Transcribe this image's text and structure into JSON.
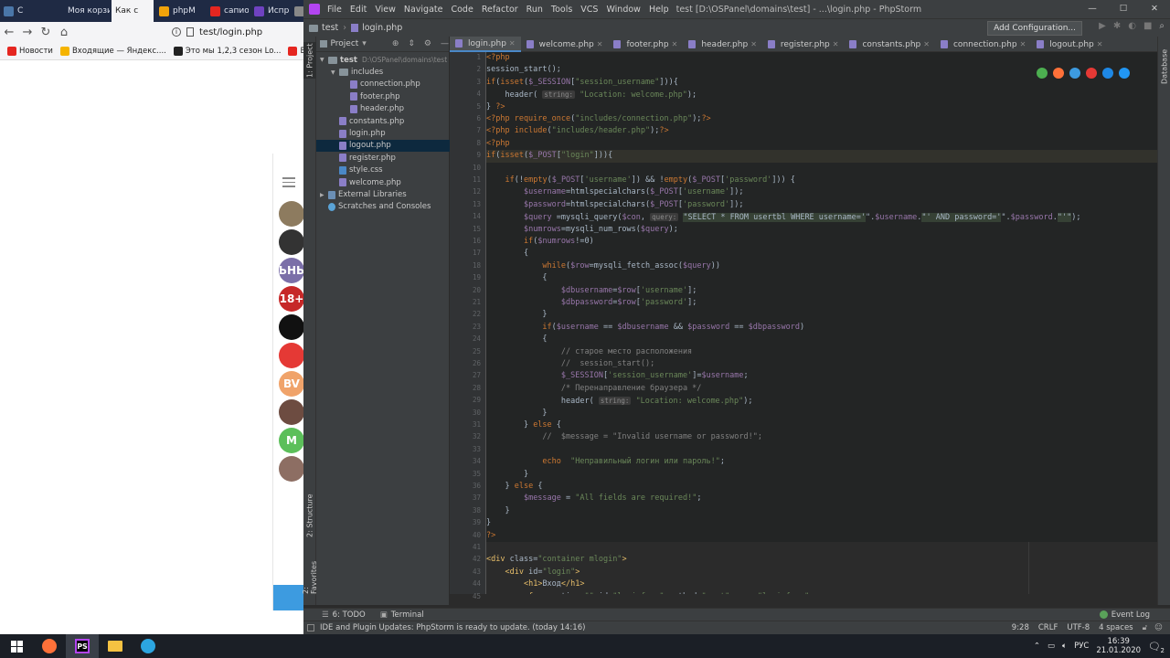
{
  "browser": {
    "tabs": [
      {
        "label": "С",
        "icon": "vk-icon",
        "color": "#4a76a8"
      },
      {
        "label": "",
        "icon": "speaker-icon",
        "color": "#1f2a44"
      },
      {
        "label": "Моя корзи",
        "icon": "",
        "color": ""
      },
      {
        "label": "Как с",
        "icon": "",
        "color": "",
        "active": true
      },
      {
        "label": "phpM",
        "icon": "phpmyadmin-icon",
        "color": "#f0a30a"
      },
      {
        "label": "сапио",
        "icon": "yandex-icon",
        "color": "#e52620"
      },
      {
        "label": "Испр",
        "icon": "hh-icon",
        "color": "#6f42c1"
      },
      {
        "label": "",
        "icon": "generic-icon",
        "color": "#888888"
      }
    ],
    "url": "test/login.php",
    "bookmarks": [
      {
        "label": "Новости",
        "color": "#e52620"
      },
      {
        "label": "Входящие — Яндекс....",
        "color": "#f5b400"
      },
      {
        "label": "Это мы 1,2,3 сезон Lo...",
        "color": "#222222"
      },
      {
        "label": "Вакансия Ju",
        "color": "#e52620"
      }
    ],
    "telegram_avatars": [
      {
        "text": "",
        "color": "#8d7b5f"
      },
      {
        "text": "",
        "color": "#333333"
      },
      {
        "text": "ЬНЬ",
        "color": "#7b6fa8"
      },
      {
        "text": "18+",
        "color": "#c62828"
      },
      {
        "text": "",
        "color": "#111111"
      },
      {
        "text": "",
        "color": "#e53935"
      },
      {
        "text": "BV",
        "color": "#f0a36a"
      },
      {
        "text": "",
        "color": "#6d4c41"
      },
      {
        "text": "M",
        "color": "#5cbf5a"
      },
      {
        "text": "",
        "color": "#8d6e63"
      }
    ]
  },
  "ide": {
    "menu": [
      "File",
      "Edit",
      "View",
      "Navigate",
      "Code",
      "Refactor",
      "Run",
      "Tools",
      "VCS",
      "Window",
      "Help"
    ],
    "title": "test [D:\\OSPanel\\domains\\test] - ...\\login.php - PhpStorm",
    "breadcrumb": [
      "test",
      "login.php"
    ],
    "add_config": "Add Configuration...",
    "project_label": "Project",
    "left_tabs": {
      "project": "1: Project",
      "structure": "2: Structure",
      "favorites": "2: Favorites"
    },
    "right_tab": "Database",
    "tree": [
      {
        "label": "test",
        "suffix": "D:\\OSPanel\\domains\\test",
        "indent": 0,
        "kind": "folder",
        "arrow": "▼"
      },
      {
        "label": "includes",
        "indent": 1,
        "kind": "folder",
        "arrow": "▼"
      },
      {
        "label": "connection.php",
        "indent": 2,
        "kind": "php"
      },
      {
        "label": "footer.php",
        "indent": 2,
        "kind": "php"
      },
      {
        "label": "header.php",
        "indent": 2,
        "kind": "php"
      },
      {
        "label": "constants.php",
        "indent": 1,
        "kind": "php"
      },
      {
        "label": "login.php",
        "indent": 1,
        "kind": "php"
      },
      {
        "label": "logout.php",
        "indent": 1,
        "kind": "php",
        "selected": true
      },
      {
        "label": "register.php",
        "indent": 1,
        "kind": "php"
      },
      {
        "label": "style.css",
        "indent": 1,
        "kind": "css"
      },
      {
        "label": "welcome.php",
        "indent": 1,
        "kind": "php"
      },
      {
        "label": "External Libraries",
        "indent": 0,
        "kind": "lib",
        "arrow": "▶"
      },
      {
        "label": "Scratches and Consoles",
        "indent": 0,
        "kind": "scratch"
      }
    ],
    "tabs": [
      "login.php",
      "welcome.php",
      "footer.php",
      "header.php",
      "register.php",
      "constants.php",
      "connection.php",
      "logout.php"
    ],
    "active_tab": "login.php",
    "code": [
      [
        [
          "kw",
          "<?php"
        ]
      ],
      [
        [
          "t",
          "session_start();"
        ]
      ],
      [
        [
          "kw",
          "if"
        ],
        [
          "t",
          "("
        ],
        [
          "kw",
          "isset"
        ],
        [
          "t",
          "("
        ],
        [
          "vr",
          "$_SESSION"
        ],
        [
          "t",
          "["
        ],
        [
          "st",
          "\"session_username\""
        ],
        [
          "t",
          "])){"
        ]
      ],
      [
        [
          "t",
          "    header( "
        ],
        [
          "hint",
          "string:"
        ],
        [
          "t",
          " "
        ],
        [
          "st",
          "\"Location: welcome.php\""
        ],
        [
          "t",
          ");"
        ]
      ],
      [
        [
          "t",
          "} "
        ],
        [
          "kw",
          "?>"
        ]
      ],
      [
        [
          "kw",
          "<?php require_once"
        ],
        [
          "t",
          "("
        ],
        [
          "st",
          "\"includes/connection.php\""
        ],
        [
          "t",
          ");"
        ],
        [
          "kw",
          "?>"
        ]
      ],
      [
        [
          "kw",
          "<?php include"
        ],
        [
          "t",
          "("
        ],
        [
          "st",
          "\"includes/header.php\""
        ],
        [
          "t",
          ");"
        ],
        [
          "kw",
          "?>"
        ]
      ],
      [
        [
          "kw",
          "<?php"
        ]
      ],
      [
        [
          "kw",
          "if"
        ],
        [
          "t",
          "("
        ],
        [
          "kw",
          "isset"
        ],
        [
          "t",
          "("
        ],
        [
          "vr",
          "$_POST"
        ],
        [
          "t",
          "["
        ],
        [
          "st",
          "\"login\""
        ],
        [
          "t",
          "])){"
        ]
      ],
      [
        [
          "t",
          ""
        ]
      ],
      [
        [
          "t",
          "    "
        ],
        [
          "kw",
          "if"
        ],
        [
          "t",
          "(!"
        ],
        [
          "kw",
          "empty"
        ],
        [
          "t",
          "("
        ],
        [
          "vr",
          "$_POST"
        ],
        [
          "t",
          "["
        ],
        [
          "st",
          "'username'"
        ],
        [
          "t",
          "]) && !"
        ],
        [
          "kw",
          "empty"
        ],
        [
          "t",
          "("
        ],
        [
          "vr",
          "$_POST"
        ],
        [
          "t",
          "["
        ],
        [
          "st",
          "'password'"
        ],
        [
          "t",
          "])) {"
        ]
      ],
      [
        [
          "t",
          "        "
        ],
        [
          "vr",
          "$username"
        ],
        [
          "t",
          "=htmlspecialchars("
        ],
        [
          "vr",
          "$_POST"
        ],
        [
          "t",
          "["
        ],
        [
          "st",
          "'username'"
        ],
        [
          "t",
          "]);"
        ]
      ],
      [
        [
          "t",
          "        "
        ],
        [
          "vr",
          "$password"
        ],
        [
          "t",
          "=htmlspecialchars("
        ],
        [
          "vr",
          "$_POST"
        ],
        [
          "t",
          "["
        ],
        [
          "st",
          "'password'"
        ],
        [
          "t",
          "]);"
        ]
      ],
      [
        [
          "t",
          "        "
        ],
        [
          "vr",
          "$query"
        ],
        [
          "t",
          " =mysqli_query("
        ],
        [
          "vr",
          "$con"
        ],
        [
          "t",
          ", "
        ],
        [
          "hint",
          "query:"
        ],
        [
          "t",
          " "
        ],
        [
          "sql",
          "\"SELECT * FROM usertbl WHERE username='"
        ],
        [
          "t",
          "\"."
        ],
        [
          "vr",
          "$username"
        ],
        [
          "t",
          "."
        ],
        [
          "sql",
          "\"' AND password='"
        ],
        [
          "t",
          "\"."
        ],
        [
          "vr",
          "$password"
        ],
        [
          "t",
          "."
        ],
        [
          "sql",
          "\"'\""
        ],
        [
          "t",
          ");"
        ]
      ],
      [
        [
          "t",
          "        "
        ],
        [
          "vr",
          "$numrows"
        ],
        [
          "t",
          "=mysqli_num_rows("
        ],
        [
          "vr",
          "$query"
        ],
        [
          "t",
          ");"
        ]
      ],
      [
        [
          "t",
          "        "
        ],
        [
          "kw",
          "if"
        ],
        [
          "t",
          "("
        ],
        [
          "vr",
          "$numrows"
        ],
        [
          "t",
          "!=0)"
        ]
      ],
      [
        [
          "t",
          "        {"
        ]
      ],
      [
        [
          "t",
          "            "
        ],
        [
          "kw",
          "while"
        ],
        [
          "t",
          "("
        ],
        [
          "vr",
          "$row"
        ],
        [
          "t",
          "=mysqli_fetch_assoc("
        ],
        [
          "vr",
          "$query"
        ],
        [
          "t",
          "))"
        ]
      ],
      [
        [
          "t",
          "            {"
        ]
      ],
      [
        [
          "t",
          "                "
        ],
        [
          "vr",
          "$dbusername"
        ],
        [
          "t",
          "="
        ],
        [
          "vr",
          "$row"
        ],
        [
          "t",
          "["
        ],
        [
          "st",
          "'username'"
        ],
        [
          "t",
          "];"
        ]
      ],
      [
        [
          "t",
          "                "
        ],
        [
          "vr",
          "$dbpassword"
        ],
        [
          "t",
          "="
        ],
        [
          "vr",
          "$row"
        ],
        [
          "t",
          "["
        ],
        [
          "st",
          "'password'"
        ],
        [
          "t",
          "];"
        ]
      ],
      [
        [
          "t",
          "            }"
        ]
      ],
      [
        [
          "t",
          "            "
        ],
        [
          "kw",
          "if"
        ],
        [
          "t",
          "("
        ],
        [
          "vr",
          "$username"
        ],
        [
          "t",
          " == "
        ],
        [
          "vr",
          "$dbusername"
        ],
        [
          "t",
          " && "
        ],
        [
          "vr",
          "$password"
        ],
        [
          "t",
          " == "
        ],
        [
          "vr",
          "$dbpassword"
        ],
        [
          "t",
          ")"
        ]
      ],
      [
        [
          "t",
          "            {"
        ]
      ],
      [
        [
          "t",
          "                "
        ],
        [
          "cm",
          "// старое место расположения"
        ]
      ],
      [
        [
          "t",
          "                "
        ],
        [
          "cm",
          "//  session_start();"
        ]
      ],
      [
        [
          "t",
          "                "
        ],
        [
          "vr",
          "$_SESSION"
        ],
        [
          "t",
          "["
        ],
        [
          "st",
          "'session_username'"
        ],
        [
          "t",
          "]="
        ],
        [
          "vr",
          "$username"
        ],
        [
          "t",
          ";"
        ]
      ],
      [
        [
          "t",
          "                "
        ],
        [
          "cm",
          "/* Перенаправление браузера */"
        ]
      ],
      [
        [
          "t",
          "                header( "
        ],
        [
          "hint",
          "string:"
        ],
        [
          "t",
          " "
        ],
        [
          "st",
          "\"Location: welcome.php\""
        ],
        [
          "t",
          ");"
        ]
      ],
      [
        [
          "t",
          "            }"
        ]
      ],
      [
        [
          "t",
          "        } "
        ],
        [
          "kw",
          "else"
        ],
        [
          "t",
          " {"
        ]
      ],
      [
        [
          "t",
          "            "
        ],
        [
          "cm",
          "//  $message = \"Invalid username or password!\";"
        ]
      ],
      [
        [
          "t",
          ""
        ]
      ],
      [
        [
          "t",
          "            "
        ],
        [
          "kw",
          "echo"
        ],
        [
          "t",
          "  "
        ],
        [
          "st",
          "\"Неправильный логин или пароль!\""
        ],
        [
          "t",
          ";"
        ]
      ],
      [
        [
          "t",
          "        }"
        ]
      ],
      [
        [
          "t",
          "    } "
        ],
        [
          "kw",
          "else"
        ],
        [
          "t",
          " {"
        ]
      ],
      [
        [
          "t",
          "        "
        ],
        [
          "vr",
          "$message"
        ],
        [
          "t",
          " = "
        ],
        [
          "st",
          "\"All fields are required!\""
        ],
        [
          "t",
          ";"
        ]
      ],
      [
        [
          "t",
          "    }"
        ]
      ],
      [
        [
          "t",
          "}"
        ]
      ],
      [
        [
          "kw",
          "?>"
        ]
      ],
      [
        [
          "t",
          ""
        ]
      ],
      [
        [
          "tg",
          "<div"
        ],
        [
          "t",
          " class="
        ],
        [
          "st",
          "\"container mlogin\""
        ],
        [
          "tg",
          ">"
        ]
      ],
      [
        [
          "t",
          "    "
        ],
        [
          "tg",
          "<div"
        ],
        [
          "t",
          " id="
        ],
        [
          "st",
          "\"login\""
        ],
        [
          "tg",
          ">"
        ]
      ],
      [
        [
          "t",
          "        "
        ],
        [
          "tg",
          "<h1>"
        ],
        [
          "t",
          "Вход"
        ],
        [
          "tg",
          "</h1>"
        ]
      ],
      [
        [
          "t",
          "        "
        ],
        [
          "tg",
          "<form"
        ],
        [
          "t",
          " action="
        ],
        [
          "st",
          "\"\""
        ],
        [
          "t",
          " id="
        ],
        [
          "st",
          "\"loginform\""
        ],
        [
          "t",
          " method="
        ],
        [
          "st",
          "\"post\""
        ],
        [
          "t",
          " name="
        ],
        [
          "st",
          "\"loginform\""
        ],
        [
          "tg",
          ">"
        ]
      ]
    ],
    "browser_icons": [
      {
        "name": "chrome-icon",
        "color": "#4caf50"
      },
      {
        "name": "firefox-icon",
        "color": "#ff7139"
      },
      {
        "name": "safari-icon",
        "color": "#3d9be0"
      },
      {
        "name": "opera-icon",
        "color": "#e53935"
      },
      {
        "name": "ie-icon",
        "color": "#1e88e5"
      },
      {
        "name": "edge-icon",
        "color": "#2196f3"
      }
    ],
    "bottom_tabs": {
      "todo": "6: TODO",
      "terminal": "Terminal",
      "event_log": "Event Log"
    },
    "status": {
      "message": "IDE and Plugin Updates: PhpStorm is ready to update. (today 14:16)",
      "position": "9:28",
      "line_sep": "CRLF",
      "encoding": "UTF-8",
      "indent": "4 spaces"
    }
  },
  "taskbar": {
    "apps": [
      {
        "name": "windows-start-icon",
        "color": "#ffffff"
      },
      {
        "name": "firefox-icon",
        "color": "#ff7139"
      },
      {
        "name": "phpstorm-icon",
        "color": "#b345f1",
        "label": "PS"
      },
      {
        "name": "explorer-icon",
        "color": "#f5c242"
      },
      {
        "name": "telegram-icon",
        "color": "#2ca5e0"
      }
    ],
    "lang": "РУС",
    "time": "16:39",
    "date": "21.01.2020",
    "notif_count": "2"
  }
}
